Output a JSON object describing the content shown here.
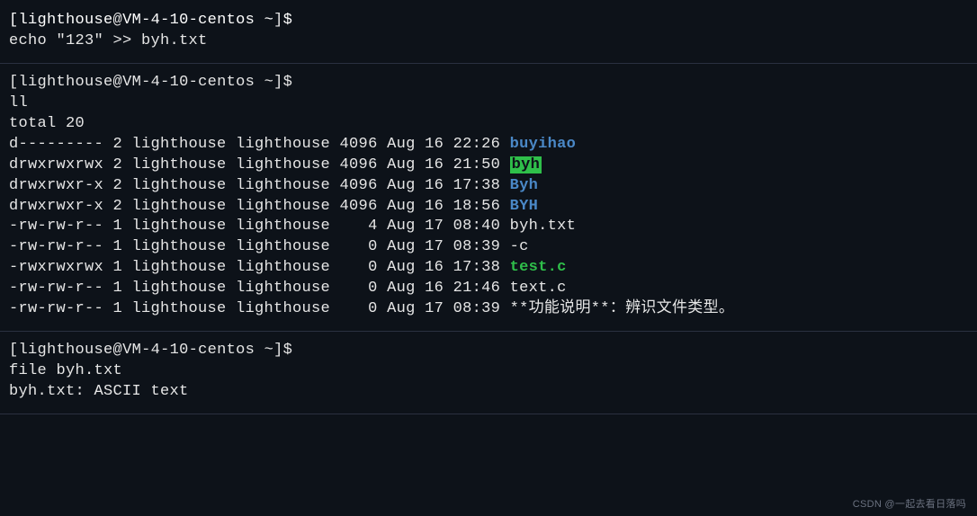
{
  "prompt": {
    "user": "lighthouse",
    "host": "VM-4-10-centos",
    "path": "~",
    "symbol": "$"
  },
  "block1": {
    "command": "echo \"123\" >> byh.txt"
  },
  "block2": {
    "command": "ll",
    "total_line": "total 20",
    "rows": [
      {
        "perm": "d---------",
        "links": "2",
        "owner": "lighthouse",
        "group": "lighthouse",
        "size": "4096",
        "date": "Aug 16 22:26",
        "name": "buyihao",
        "style": "dir-blue"
      },
      {
        "perm": "drwxrwxrwx",
        "links": "2",
        "owner": "lighthouse",
        "group": "lighthouse",
        "size": "4096",
        "date": "Aug 16 21:50",
        "name": "byh",
        "style": "highlight"
      },
      {
        "perm": "drwxrwxr-x",
        "links": "2",
        "owner": "lighthouse",
        "group": "lighthouse",
        "size": "4096",
        "date": "Aug 16 17:38",
        "name": "Byh",
        "style": "dir-blue"
      },
      {
        "perm": "drwxrwxr-x",
        "links": "2",
        "owner": "lighthouse",
        "group": "lighthouse",
        "size": "4096",
        "date": "Aug 16 18:56",
        "name": "BYH",
        "style": "dir-blue"
      },
      {
        "perm": "-rw-rw-r--",
        "links": "1",
        "owner": "lighthouse",
        "group": "lighthouse",
        "size": "   4",
        "date": "Aug 17 08:40",
        "name": "byh.txt",
        "style": "plain"
      },
      {
        "perm": "-rw-rw-r--",
        "links": "1",
        "owner": "lighthouse",
        "group": "lighthouse",
        "size": "   0",
        "date": "Aug 17 08:39",
        "name": "-c",
        "style": "plain"
      },
      {
        "perm": "-rwxrwxrwx",
        "links": "1",
        "owner": "lighthouse",
        "group": "lighthouse",
        "size": "   0",
        "date": "Aug 16 17:38",
        "name": "test.c",
        "style": "exec-green"
      },
      {
        "perm": "-rw-rw-r--",
        "links": "1",
        "owner": "lighthouse",
        "group": "lighthouse",
        "size": "   0",
        "date": "Aug 16 21:46",
        "name": "text.c",
        "style": "plain"
      },
      {
        "perm": "-rw-rw-r--",
        "links": "1",
        "owner": "lighthouse",
        "group": "lighthouse",
        "size": "   0",
        "date": "Aug 17 08:39",
        "name": "**功能说明**：辨识文件类型。",
        "style": "plain"
      }
    ]
  },
  "block3": {
    "command": "file byh.txt",
    "output": "byh.txt: ASCII text"
  },
  "watermark": "CSDN @一起去看日落吗"
}
